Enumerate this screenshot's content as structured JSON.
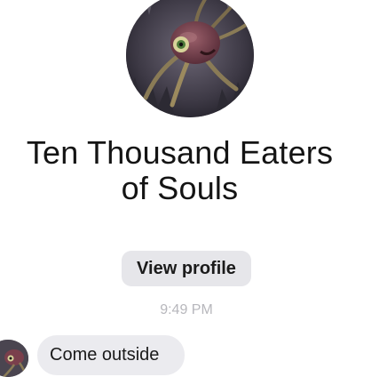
{
  "contact": {
    "name_line1": "Ten Thousand Eaters",
    "name_line2": "of Souls",
    "avatar_icon": "creature-avatar-icon"
  },
  "profile": {
    "view_profile_label": "View profile"
  },
  "thread": {
    "timestamp": "9:49 PM",
    "messages": [
      {
        "sender": "contact",
        "text": "Come outside"
      }
    ]
  },
  "colors": {
    "background": "#ffffff",
    "bubble": "#ebebef",
    "button": "#e6e6ea",
    "timestamp": "#b7b7bc",
    "name_text": "#141414"
  }
}
